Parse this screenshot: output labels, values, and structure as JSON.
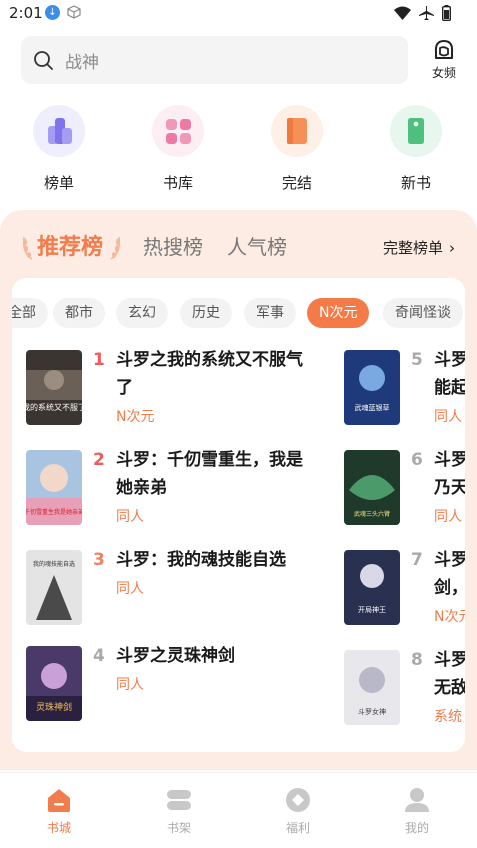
{
  "status_bar": {
    "time": "2:01"
  },
  "header": {
    "search_placeholder": "战神",
    "gender_label": "女频"
  },
  "entries": [
    {
      "label": "榜单",
      "icon": "ranking-icon",
      "color": "#8f86ee"
    },
    {
      "label": "书库",
      "icon": "library-grid-icon",
      "color": "#ef7fa8"
    },
    {
      "label": "完结",
      "icon": "finished-book-icon",
      "color": "#f48a4f"
    },
    {
      "label": "新书",
      "icon": "new-book-tag-icon",
      "color": "#4dbf7e"
    }
  ],
  "ranking": {
    "tabs": [
      "推荐榜",
      "热搜榜",
      "人气榜"
    ],
    "active_tab": "推荐榜",
    "full_link": "完整榜单",
    "categories": [
      "全部",
      "都市",
      "玄幻",
      "历史",
      "军事",
      "N次元",
      "奇闻怪谈"
    ],
    "active_category": "N次元",
    "books": [
      {
        "rank": "1",
        "title": "斗罗之我的系统又不服气了",
        "tag": "N次元",
        "cover_text": "我的系统又不服了"
      },
      {
        "rank": "2",
        "title": "斗罗：千仞雪重生，我是她亲弟",
        "tag": "同人",
        "cover_text": "千仞雪重生我是她亲弟"
      },
      {
        "rank": "3",
        "title": "斗罗：我的魂技能自选",
        "tag": "同人",
        "cover_text": "我的魂技能自选"
      },
      {
        "rank": "4",
        "title": "斗罗之灵珠神剑",
        "tag": "同人",
        "cover_text": "灵珠神剑"
      },
      {
        "rank": "5",
        "title": "斗罗能起",
        "tag": "同人",
        "cover_text": "武魂蓝银草"
      },
      {
        "rank": "6",
        "title": "斗罗乃天",
        "tag": "同人",
        "cover_text": "武魂三头六臂"
      },
      {
        "rank": "7",
        "title": "斗罗剑，",
        "tag": "N次元",
        "cover_text": "开局神王"
      },
      {
        "rank": "8",
        "title": "斗罗无敌",
        "tag": "系统",
        "cover_text": "斗罗女神"
      }
    ],
    "rank_colors": {
      "top": "#f05a5a",
      "mid": "#f08060",
      "normal": "#aaaaaa"
    }
  },
  "bottom_nav": [
    {
      "label": "书城",
      "icon": "home-icon",
      "active": true
    },
    {
      "label": "书架",
      "icon": "bookshelf-icon",
      "active": false
    },
    {
      "label": "福利",
      "icon": "coin-icon",
      "active": false
    },
    {
      "label": "我的",
      "icon": "profile-icon",
      "active": false
    }
  ],
  "colors": {
    "accent": "#f27c4b",
    "rank_bg": "#fdece3"
  }
}
